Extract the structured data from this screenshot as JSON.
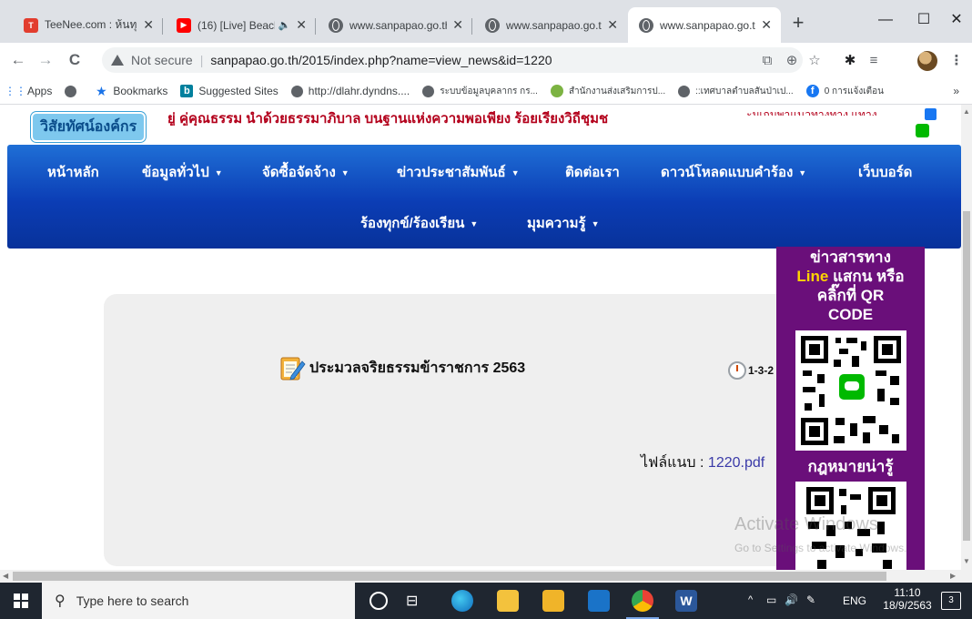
{
  "browser": {
    "tabs": [
      {
        "title": "TeeNee.com : ห้นทุกเ",
        "favicon_color": "#e23d2e",
        "close": "✕",
        "active": false
      },
      {
        "title": "(16) [Live] Beach",
        "favicon_color": "#ff0000",
        "close": "✕",
        "active": false,
        "audio": true
      },
      {
        "title": "www.sanpapao.go.th",
        "close": "✕",
        "active": false
      },
      {
        "title": "www.sanpapao.go.th",
        "close": "✕",
        "active": false
      },
      {
        "title": "www.sanpapao.go.th",
        "close": "✕",
        "active": true
      }
    ],
    "new_tab": "+",
    "window_controls": {
      "minimize": "—",
      "maximize": "☐",
      "close": "✕"
    },
    "toolbar": {
      "back": "←",
      "forward": "→",
      "reload": "C",
      "not_secure": "Not secure",
      "url": "sanpapao.go.th/2015/index.php?name=view_news&id=1220"
    },
    "bookmarks": [
      {
        "label": "Apps",
        "icon": "apps-grid-icon"
      },
      {
        "label": "",
        "icon": "globe-icon"
      },
      {
        "label": "Bookmarks",
        "icon": "star-icon"
      },
      {
        "label": "Suggested Sites",
        "icon": "bing-icon"
      },
      {
        "label": "http://dlahr.dyndns....",
        "icon": "globe-icon"
      },
      {
        "label": "ระบบข้อมูลบุคลากร กร...",
        "icon": "globe-icon"
      },
      {
        "label": "สำนักงานส่งเสริมการป...",
        "icon": "circle-icon"
      },
      {
        "label": "::เทศบาลตำบลสันป่าเป...",
        "icon": "globe-icon"
      },
      {
        "label": "0 การแจ้งเตือน",
        "icon": "facebook-icon"
      }
    ],
    "bookmarks_overflow": "»"
  },
  "site": {
    "badge": "วิสัยทัศน์องค์กร",
    "slogan": "ยู่ คู่คุณธรรม นำด้วยธรรมาภิบาล บนฐานแห่งความพอเพียง ร้อยเรียงวิถีชุมช",
    "slogan_right": "ะมเกมพาแนวทางทาง  แทาง",
    "nav_row1": [
      {
        "label": "หน้าหลัก",
        "caret": false
      },
      {
        "label": "ข้อมูลทั่วไป",
        "caret": true
      },
      {
        "label": "จัดซื้อจัดจ้าง",
        "caret": true
      },
      {
        "label": "ข่าวประชาสัมพันธ์",
        "caret": true
      },
      {
        "label": "ติดต่อเรา",
        "caret": false
      },
      {
        "label": "ดาวน์โหลดแบบคำร้อง",
        "caret": true
      },
      {
        "label": "เว็บบอร์ด",
        "caret": false
      }
    ],
    "nav_row2": [
      {
        "label": "ร้องทุกข์/ร้องเรียน",
        "caret": true
      },
      {
        "label": "มุมความรู้",
        "caret": true
      }
    ],
    "caret": "▼"
  },
  "news": {
    "title": "ประมวลจริยธรรมข้าราชการ 2563",
    "date": "1-3-2",
    "attachment_label": "ไฟล์แนบ : ",
    "attachment_file": "1220.pdf"
  },
  "sidepanel": {
    "line1": "ข่าวสารทาง",
    "line2_yellow": "Line",
    "line2_rest": " แสกน หรือ",
    "line3": "คลิ๊กที่ QR",
    "line4": "CODE",
    "section2": "กฎหมายน่ารู้"
  },
  "watermark": {
    "title": "Activate Windows",
    "subtitle": "Go to Settings to activate Windows."
  },
  "taskbar": {
    "search_placeholder": "Type here to search",
    "tray_lang": "ENG",
    "time": "11:10",
    "date": "18/9/2563",
    "notifications": "3"
  }
}
